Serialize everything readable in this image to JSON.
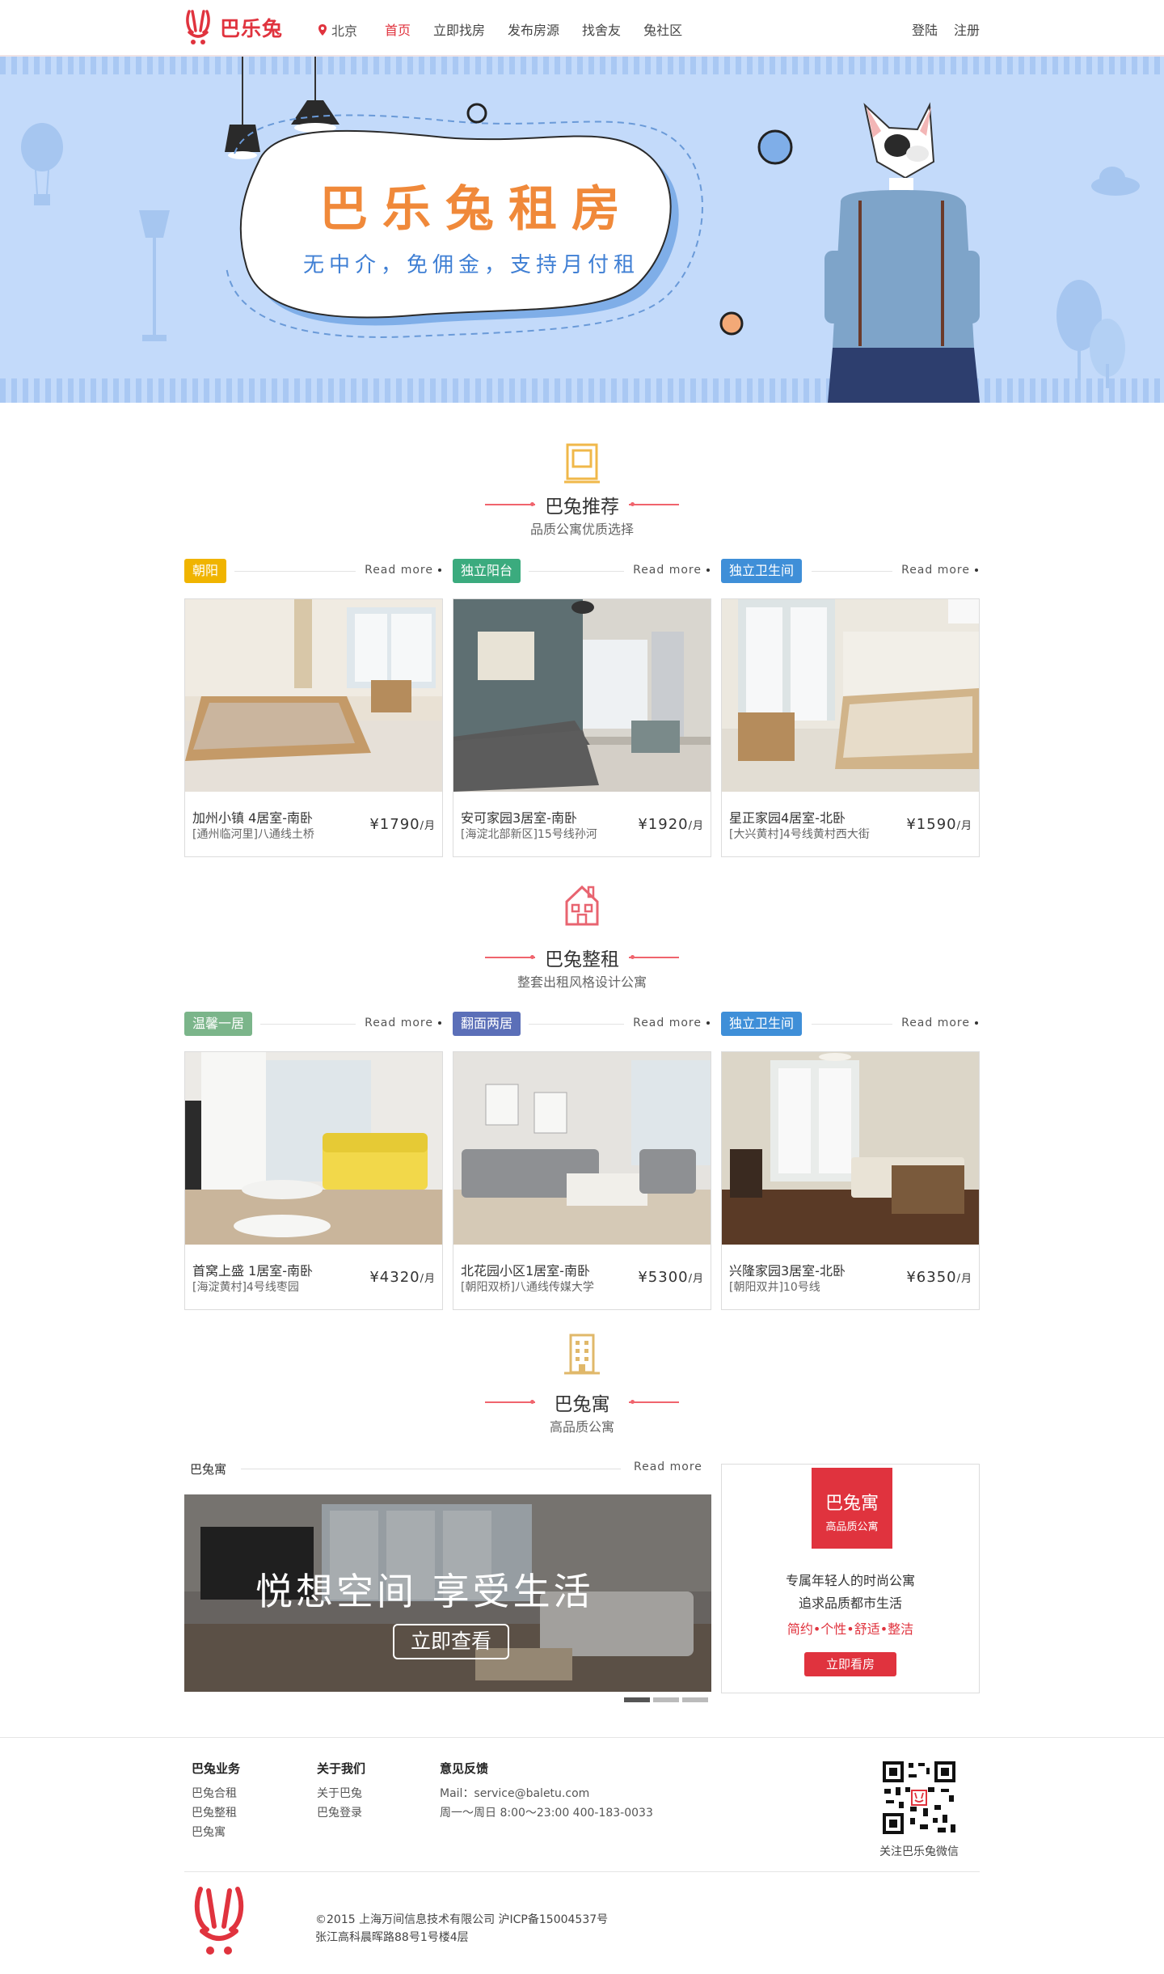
{
  "header": {
    "logo_text": "巴乐兔",
    "city": "北京",
    "nav": [
      "首页",
      "立即找房",
      "发布房源",
      "找舍友",
      "兔社区"
    ],
    "login": "登陆",
    "register": "注册",
    "accent": "#e0333e"
  },
  "banner": {
    "title": "巴乐兔租房",
    "subtitle": "无中介，免佣金，支持月付租"
  },
  "recommend": {
    "title": "巴兔推荐",
    "subtitle": "品质公寓优质选择",
    "icon": "window-icon",
    "read_more": "Read more",
    "tags": [
      {
        "label": "朝阳",
        "color": "#f0b400"
      },
      {
        "label": "独立阳台",
        "color": "#3bab7e"
      },
      {
        "label": "独立卫生间",
        "color": "#3f8fd8"
      }
    ],
    "cards": [
      {
        "name": "加州小镇 4居室-南卧",
        "location": "[通州临河里]八通线土桥",
        "price": "¥1790",
        "unit": "/月"
      },
      {
        "name": "安可家园3居室-南卧",
        "location": "[海淀北部新区]15号线孙河",
        "price": "¥1920",
        "unit": "/月"
      },
      {
        "name": "星正家园4居室-北卧",
        "location": "[大兴黄村]4号线黄村西大街",
        "price": "¥1590",
        "unit": "/月"
      }
    ]
  },
  "whole": {
    "title": "巴兔整租",
    "subtitle": "整套出租风格设计公寓",
    "icon": "house-icon",
    "read_more": "Read more",
    "tags": [
      {
        "label": "温馨一居",
        "color": "#7bb58a"
      },
      {
        "label": "翻面两居",
        "color": "#5b6fb8"
      },
      {
        "label": "独立卫生间",
        "color": "#3f8fd8"
      }
    ],
    "cards": [
      {
        "name": "首窝上盛 1居室-南卧",
        "location": "[海淀黄村]4号线枣园",
        "price": "¥4320",
        "unit": "/月"
      },
      {
        "name": "北花园小区1居室-南卧",
        "location": "[朝阳双桥]八通线传媒大学",
        "price": "¥5300",
        "unit": "/月"
      },
      {
        "name": "兴隆家园3居室-北卧",
        "location": "[朝阳双井]10号线",
        "price": "¥6350",
        "unit": "/月"
      }
    ]
  },
  "apartment": {
    "title": "巴兔寓",
    "subtitle": "高品质公寓",
    "icon": "building-icon",
    "label": "巴兔寓",
    "read_more": "Read more",
    "slide_text": "悦想空间   享受生活",
    "slide_button": "立即查看",
    "promo": {
      "badge_title": "巴兔寓",
      "badge_sub": "高品质公寓",
      "line1": "专属年轻人的时尚公寓",
      "line2": "追求品质都市生活",
      "line3": "简约•个性•舒适•整洁",
      "button": "立即看房"
    }
  },
  "footer": {
    "col1": {
      "title": "巴兔业务",
      "items": [
        "巴兔合租",
        "巴兔整租",
        "巴兔寓"
      ]
    },
    "col2": {
      "title": "关于我们",
      "items": [
        "关于巴兔",
        "巴兔登录"
      ]
    },
    "col3": {
      "title": "意见反馈",
      "mail": "Mail：service@baletu.com",
      "hours": "周一～周日 8:00～23:00 400-183-0033"
    },
    "qr_caption": "关注巴乐兔微信",
    "copyright": "©2015 上海万间信息技术有限公司     沪ICP备15004537号",
    "address": "张江高科晨晖路88号1号楼4层"
  }
}
